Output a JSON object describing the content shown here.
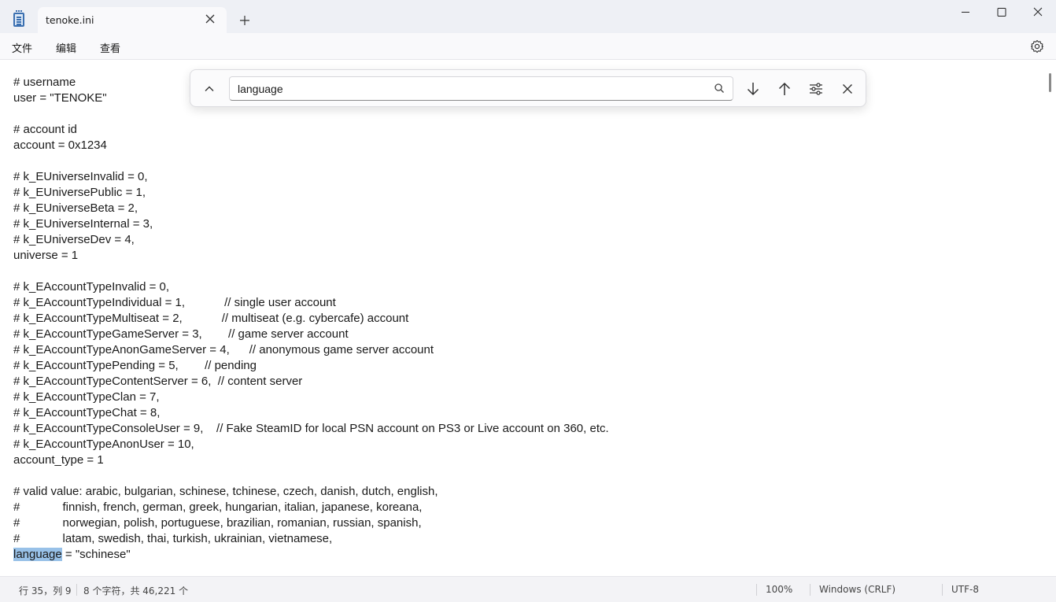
{
  "window": {
    "tab_title": "tenoke.ini"
  },
  "menu": {
    "file": "文件",
    "edit": "编辑",
    "view": "查看"
  },
  "find": {
    "query": "language"
  },
  "editor": {
    "lines": [
      "# username",
      "user = \"TENOKE\"",
      "",
      "# account id",
      "account = 0x1234",
      "",
      "# k_EUniverseInvalid = 0,",
      "# k_EUniversePublic = 1,",
      "# k_EUniverseBeta = 2,",
      "# k_EUniverseInternal = 3,",
      "# k_EUniverseDev = 4,",
      "universe = 1",
      "",
      "# k_EAccountTypeInvalid = 0,",
      "# k_EAccountTypeIndividual = 1,            // single user account",
      "# k_EAccountTypeMultiseat = 2,            // multiseat (e.g. cybercafe) account",
      "# k_EAccountTypeGameServer = 3,        // game server account",
      "# k_EAccountTypeAnonGameServer = 4,      // anonymous game server account",
      "# k_EAccountTypePending = 5,        // pending",
      "# k_EAccountTypeContentServer = 6,  // content server",
      "# k_EAccountTypeClan = 7,",
      "# k_EAccountTypeChat = 8,",
      "# k_EAccountTypeConsoleUser = 9,    // Fake SteamID for local PSN account on PS3 or Live account on 360, etc.",
      "# k_EAccountTypeAnonUser = 10,",
      "account_type = 1",
      "",
      "# valid value: arabic, bulgarian, schinese, tchinese, czech, danish, dutch, english,",
      "#             finnish, french, german, greek, hungarian, italian, japanese, koreana,",
      "#             norwegian, polish, portuguese, brazilian, romanian, russian, spanish,",
      "#             latam, swedish, thai, turkish, ukrainian, vietnamese,"
    ],
    "last_line_match": "language",
    "last_line_rest": " = \"schinese\""
  },
  "status": {
    "position": "行 35，列 9",
    "selection": "8 个字符，共 46,221 个",
    "zoom": "100%",
    "line_ending": "Windows (CRLF)",
    "encoding": "UTF-8"
  }
}
